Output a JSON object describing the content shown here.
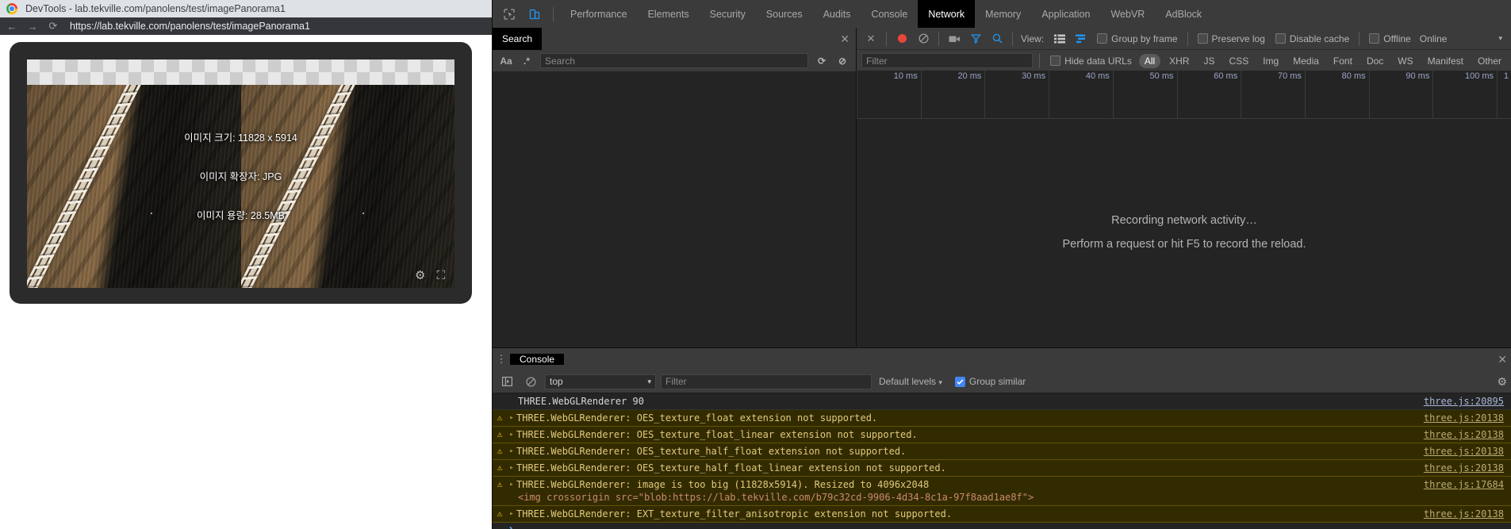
{
  "window": {
    "title": "DevTools - lab.tekville.com/panolens/test/imagePanorama1",
    "minimize": "─",
    "maximize": "□",
    "close": "✕"
  },
  "browser": {
    "back_icon": "←",
    "forward_icon": "→",
    "reload_icon": "⟳",
    "url": "https://lab.tekville.com/panolens/test/imagePanorama1",
    "warning_count": "6"
  },
  "viewer": {
    "info_size": "이미지 크기: 11828 x 5914",
    "info_ext": "이미지 확장자: JPG",
    "info_bytes": "이미지 용량: 28.5MB",
    "settings_icon": "⚙",
    "fullscreen_icon": "⛶"
  },
  "devtools": {
    "inspect_icon": "inspect-element-icon",
    "device_icon": "toggle-device-toolbar-icon",
    "tabs": [
      {
        "label": "Performance",
        "active": false
      },
      {
        "label": "Elements",
        "active": false
      },
      {
        "label": "Security",
        "active": false
      },
      {
        "label": "Sources",
        "active": false
      },
      {
        "label": "Audits",
        "active": false
      },
      {
        "label": "Console",
        "active": false
      },
      {
        "label": "Network",
        "active": true
      },
      {
        "label": "Memory",
        "active": false
      },
      {
        "label": "Application",
        "active": false
      },
      {
        "label": "WebVR",
        "active": false
      },
      {
        "label": "AdBlock",
        "active": false
      }
    ]
  },
  "search": {
    "tab_label": "Search",
    "close_icon": "✕",
    "match_case_icon": "Aa",
    "regex_icon": ".*",
    "placeholder": "Search",
    "refresh_icon": "⟳",
    "clear_icon": "⊘"
  },
  "network": {
    "close_icon": "✕",
    "record_icon": "record-button",
    "clear_icon": "⊘",
    "capture_screenshots_icon": "camera-icon",
    "filter_icon": "funnel-icon",
    "search_icon": "magnifier-icon",
    "view_label": "View:",
    "list_view_icon": "list-view-icon",
    "waterfall_view_icon": "waterfall-view-icon",
    "group_by_frame": "Group by frame",
    "preserve_log": "Preserve log",
    "disable_cache": "Disable cache",
    "offline": "Offline",
    "throttling": "Online",
    "more_icon": "▾",
    "filter_placeholder": "Filter",
    "hide_data_urls": "Hide data URLs",
    "types": [
      {
        "label": "All",
        "active": true
      },
      {
        "label": "XHR",
        "active": false
      },
      {
        "label": "JS",
        "active": false
      },
      {
        "label": "CSS",
        "active": false
      },
      {
        "label": "Img",
        "active": false
      },
      {
        "label": "Media",
        "active": false
      },
      {
        "label": "Font",
        "active": false
      },
      {
        "label": "Doc",
        "active": false
      },
      {
        "label": "WS",
        "active": false
      },
      {
        "label": "Manifest",
        "active": false
      },
      {
        "label": "Other",
        "active": false
      }
    ],
    "timeline_ticks": [
      "10 ms",
      "20 ms",
      "30 ms",
      "40 ms",
      "50 ms",
      "60 ms",
      "70 ms",
      "80 ms",
      "90 ms",
      "100 ms",
      "1"
    ],
    "empty_title": "Recording network activity…",
    "empty_hint": "Perform a request or hit F5 to record the reload."
  },
  "console": {
    "tab_label": "Console",
    "close_icon": "✕",
    "kebab_icon": "⋮",
    "sidebar_icon": "show-console-sidebar-icon",
    "clear_icon": "⊘",
    "context": "top",
    "context_caret": "▾",
    "filter_placeholder": "Filter",
    "levels": "Default levels",
    "levels_caret": "▾",
    "group_similar": "Group similar",
    "settings_icon": "⚙",
    "warn_icon": "⚠",
    "expand_icon": "▸",
    "prompt_icon": "❯",
    "messages": [
      {
        "level": "info",
        "text": "THREE.WebGLRenderer 90",
        "source": "three.js:20895"
      },
      {
        "level": "warn",
        "text": "THREE.WebGLRenderer: OES_texture_float extension not supported.",
        "source": "three.js:20138"
      },
      {
        "level": "warn",
        "text": "THREE.WebGLRenderer: OES_texture_float_linear extension not supported.",
        "source": "three.js:20138"
      },
      {
        "level": "warn",
        "text": "THREE.WebGLRenderer: OES_texture_half_float extension not supported.",
        "source": "three.js:20138"
      },
      {
        "level": "warn",
        "text": "THREE.WebGLRenderer: OES_texture_half_float_linear extension not supported.",
        "source": "three.js:20138"
      },
      {
        "level": "warn",
        "text": "THREE.WebGLRenderer: image is too big (11828x5914). Resized to 4096x2048",
        "detail": "<img crossorigin src=\"blob:https://lab.tekville.com/b79c32cd-9906-4d34-8c1a-97f8aad1ae8f\">",
        "source": "three.js:17684"
      },
      {
        "level": "warn",
        "text": "THREE.WebGLRenderer: EXT_texture_filter_anisotropic extension not supported.",
        "source": "three.js:20138"
      }
    ]
  }
}
